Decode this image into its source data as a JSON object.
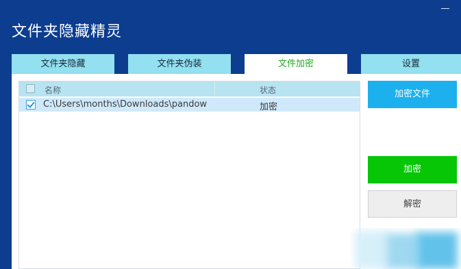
{
  "app": {
    "title": "文件夹隐藏精灵"
  },
  "tabs": [
    {
      "label": "文件夹隐藏",
      "active": false
    },
    {
      "label": "文件夹伪装",
      "active": false
    },
    {
      "label": "文件加密",
      "active": true
    },
    {
      "label": "设置",
      "active": false
    }
  ],
  "file_list": {
    "columns": {
      "name": "名称",
      "status": "状态"
    },
    "header_checked": false,
    "rows": [
      {
        "checked": true,
        "path": "C:\\Users\\months\\Downloads\\pandow",
        "status": "加密"
      }
    ]
  },
  "actions": {
    "encrypt_file_label": "加密文件",
    "encrypt_label": "加密",
    "decrypt_label": "解密"
  },
  "colors": {
    "window_bg": "#0c3d8f",
    "tab_bg": "#92e0f0",
    "active_tab_text": "#22aa22",
    "encrypt_file_button": "#1cb0ee",
    "encrypt_button": "#06c606",
    "selected_row": "#cfe9fb"
  },
  "icons": {
    "minimize": "minimize-icon",
    "checkbox": "checkbox-icon"
  }
}
